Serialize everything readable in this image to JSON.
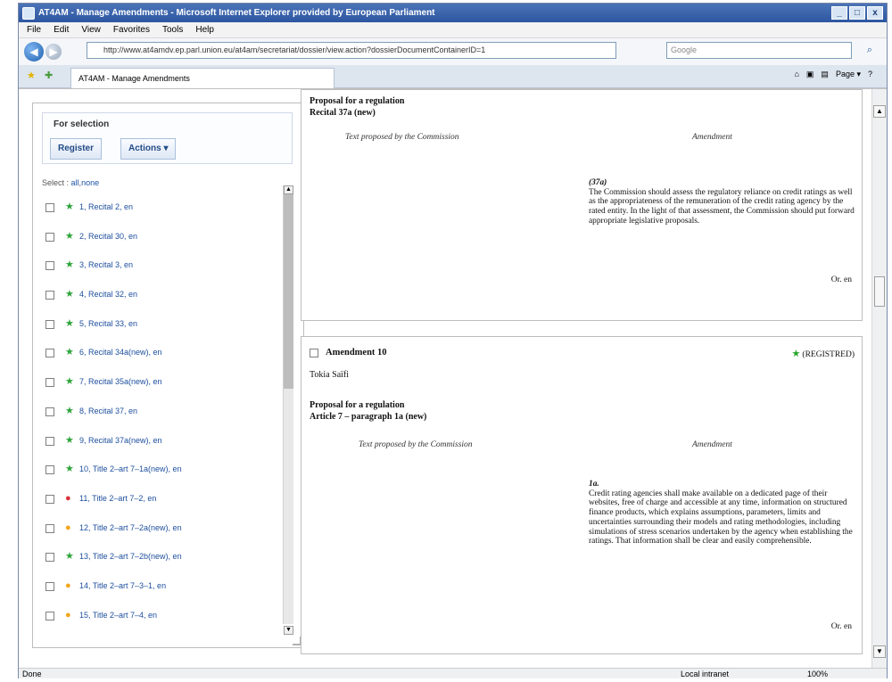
{
  "window": {
    "title": "AT4AM - Manage Amendments - Microsoft Internet Explorer provided by European Parliament"
  },
  "menu": [
    "File",
    "Edit",
    "View",
    "Favorites",
    "Tools",
    "Help"
  ],
  "address": "http://www.at4amdv.ep.parl.union.eu/at4am/secretariat/dossier/view.action?dossierDocumentContainerID=1",
  "search_placeholder": "Google",
  "tab_title": "AT4AM - Manage Amendments",
  "left": {
    "selection_title": "For selection",
    "register_label": "Register",
    "actions_label": "Actions ▾",
    "select_prefix": "Select :",
    "select_all": "all",
    "select_none": "none",
    "items": [
      {
        "label": "1, Recital 2, en",
        "mark": "★",
        "color": "#2ea43a"
      },
      {
        "label": "2, Recital 30, en",
        "mark": "★",
        "color": "#2ea43a"
      },
      {
        "label": "3, Recital 3, en",
        "mark": "★",
        "color": "#2ea43a"
      },
      {
        "label": "4, Recital 32, en",
        "mark": "★",
        "color": "#2ea43a"
      },
      {
        "label": "5, Recital 33, en",
        "mark": "★",
        "color": "#2ea43a"
      },
      {
        "label": "6, Recital 34a(new), en",
        "mark": "★",
        "color": "#2ea43a"
      },
      {
        "label": "7, Recital 35a(new), en",
        "mark": "★",
        "color": "#2ea43a"
      },
      {
        "label": "8, Recital 37, en",
        "mark": "★",
        "color": "#2ea43a"
      },
      {
        "label": "9, Recital 37a(new), en",
        "mark": "★",
        "color": "#2ea43a"
      },
      {
        "label": "10, Title 2–art 7–1a(new), en",
        "mark": "★",
        "color": "#2ea43a"
      },
      {
        "label": "11, Title 2–art 7–2, en",
        "mark": "●",
        "color": "#d8313a"
      },
      {
        "label": "12, Title 2–art 7–2a(new), en",
        "mark": "●",
        "color": "#f2a51c"
      },
      {
        "label": "13, Title 2–art 7–2b(new), en",
        "mark": "★",
        "color": "#2ea43a"
      },
      {
        "label": "14, Title 2–art 7–3–1, en",
        "mark": "●",
        "color": "#f2a51c"
      },
      {
        "label": "15, Title 2–art 7–4, en",
        "mark": "●",
        "color": "#f2a51c"
      }
    ]
  },
  "main": {
    "panel1": {
      "line1": "Proposal for a regulation",
      "line2": "Recital 37a (new)",
      "col_left": "Text proposed by the Commission",
      "col_right": "Amendment",
      "amend_no": "(37a)",
      "amend_text": "The Commission should assess the regulatory reliance on credit ratings as well as the appropriateness of the remuneration of the credit rating agency by the rated entity. In the light of that assessment, the Commission should put forward appropriate legislative proposals.",
      "lang": "Or. en"
    },
    "panel2": {
      "title": "Amendment 10",
      "status": "(REGISTRED)",
      "author": "Tokia Saïfi",
      "line1": "Proposal for a regulation",
      "line2": "Article 7 – paragraph 1a (new)",
      "col_left": "Text proposed by the Commission",
      "col_right": "Amendment",
      "amend_no": "1a.",
      "amend_text": "Credit rating agencies shall make available on a dedicated page of their websites, free of charge and accessible at any time, information on structured finance products, which explains assumptions, parameters, limits and uncertainties surrounding their models and rating methodologies, including simulations of stress scenarios undertaken by the agency when establishing the ratings. That information shall be clear and easily comprehensible.",
      "lang": "Or. en"
    }
  },
  "status": {
    "left": "Done",
    "zone": "Local intranet",
    "zoom": "100%"
  }
}
